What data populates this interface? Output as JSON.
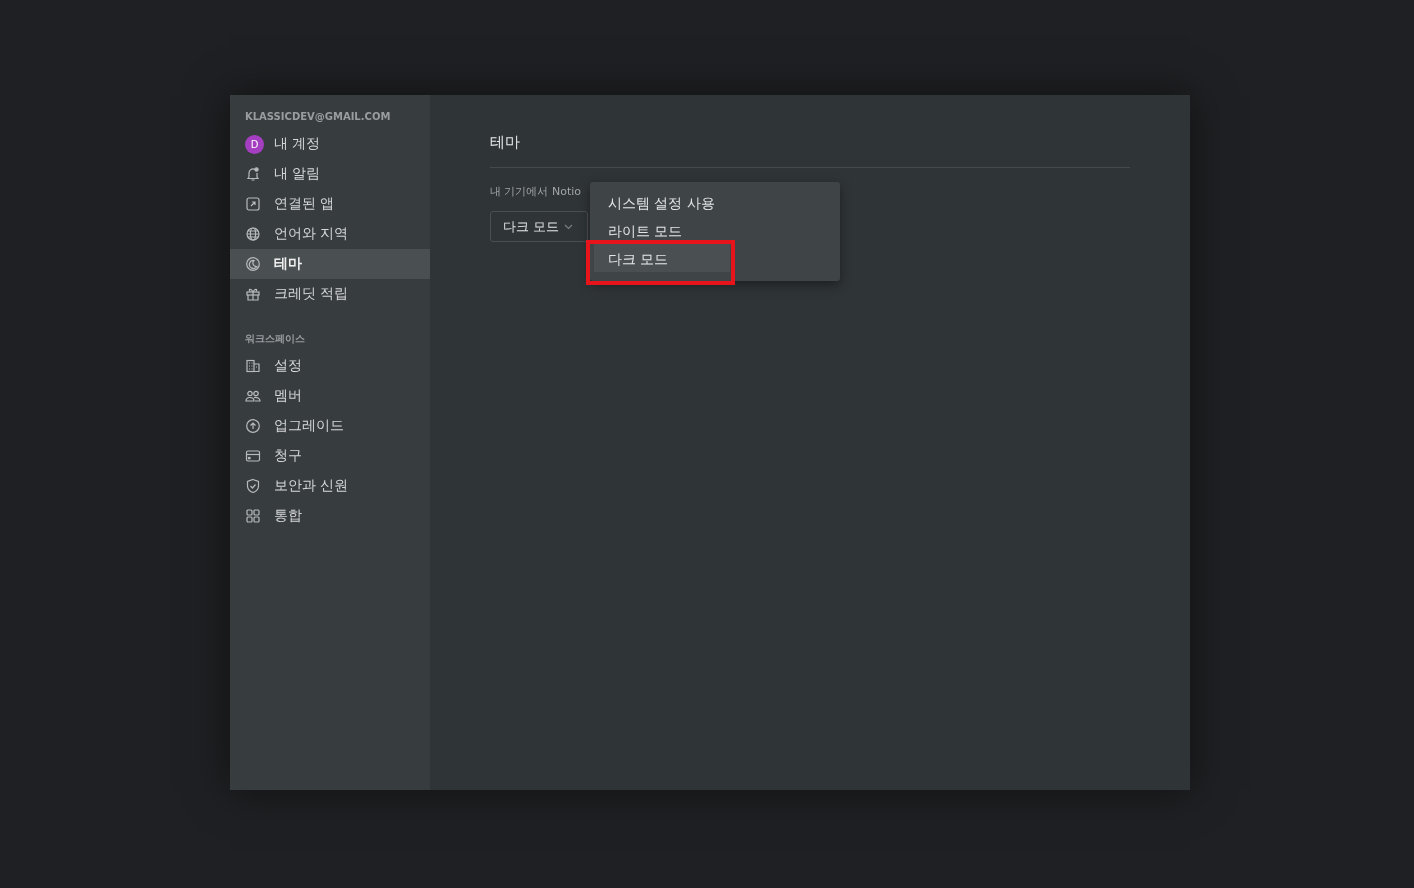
{
  "sidebar": {
    "account_label": "KLASSICDEV@GMAIL.COM",
    "avatar_letter": "D",
    "account_items": [
      {
        "label": "내 계정",
        "selected": false
      },
      {
        "label": "내 알림",
        "selected": false
      },
      {
        "label": "연결된 앱",
        "selected": false
      },
      {
        "label": "언어와 지역",
        "selected": false
      },
      {
        "label": "테마",
        "selected": true
      },
      {
        "label": "크레딧 적립",
        "selected": false
      }
    ],
    "workspace_label": "워크스페이스",
    "workspace_items": [
      {
        "label": "설정",
        "selected": false
      },
      {
        "label": "멤버",
        "selected": false
      },
      {
        "label": "업그레이드",
        "selected": false
      },
      {
        "label": "청구",
        "selected": false
      },
      {
        "label": "보안과 신원",
        "selected": false
      },
      {
        "label": "통합",
        "selected": false
      }
    ]
  },
  "main": {
    "title": "테마",
    "description": "내 기기에서 Notio",
    "select_value": "다크 모드"
  },
  "menu": {
    "items": [
      {
        "label": "시스템 설정 사용",
        "selected": false
      },
      {
        "label": "라이트 모드",
        "selected": false
      },
      {
        "label": "다크 모드",
        "selected": true,
        "highlighted": true
      }
    ]
  }
}
